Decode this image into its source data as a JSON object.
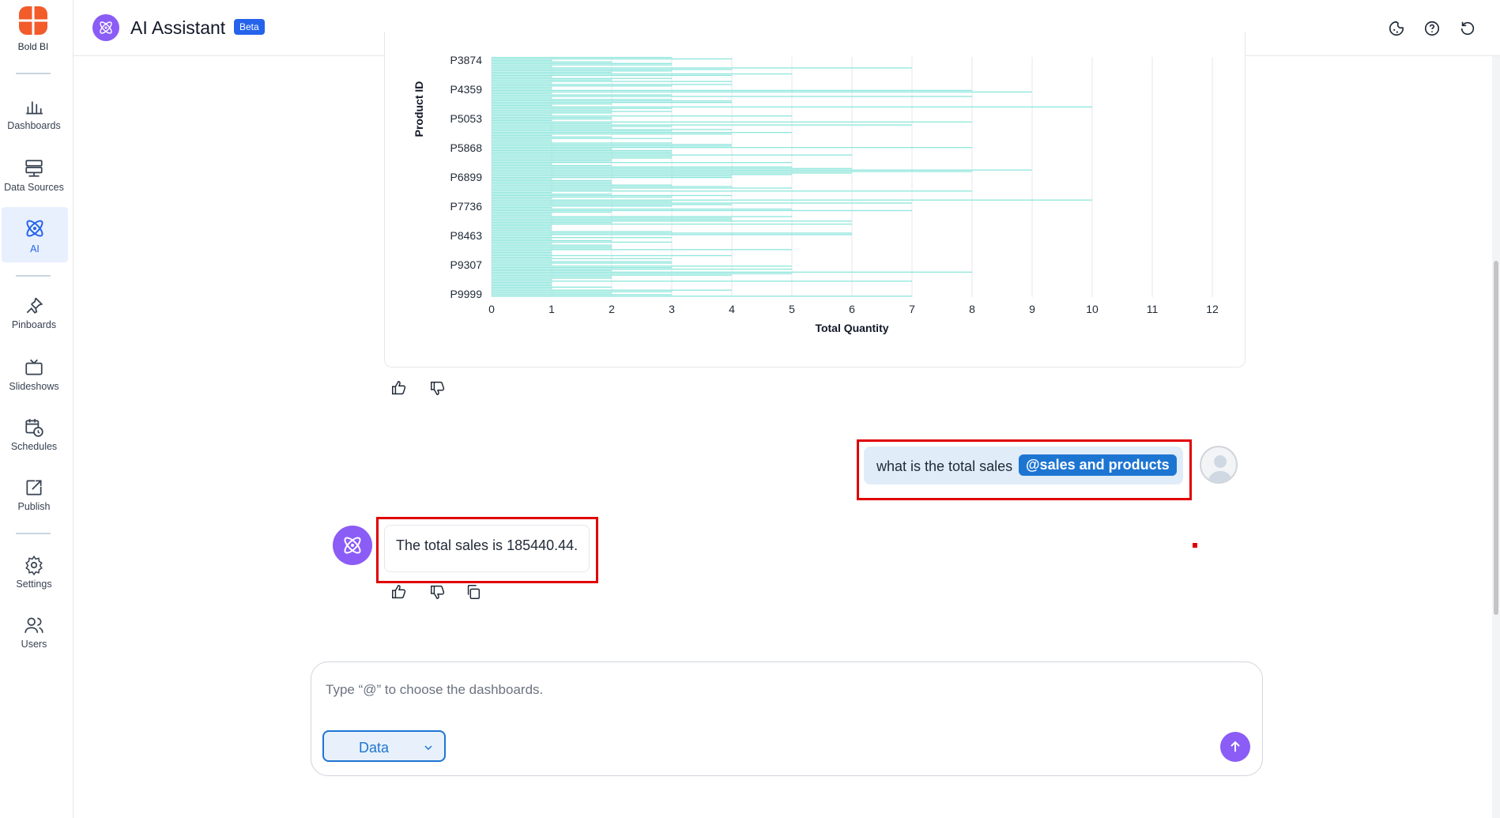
{
  "app": {
    "brand": "Bold BI",
    "title": "AI Assistant",
    "badge": "Beta"
  },
  "sidebar": {
    "items": [
      {
        "label": "Dashboards",
        "icon": "bar-chart-icon"
      },
      {
        "label": "Data Sources",
        "icon": "server-icon"
      },
      {
        "label": "AI",
        "icon": "atom-icon",
        "active": true
      },
      {
        "label": "Pinboards",
        "icon": "pin-icon"
      },
      {
        "label": "Slideshows",
        "icon": "tv-icon"
      },
      {
        "label": "Schedules",
        "icon": "calendar-clock-icon"
      },
      {
        "label": "Publish",
        "icon": "publish-icon"
      },
      {
        "label": "Settings",
        "icon": "gear-icon"
      },
      {
        "label": "Users",
        "icon": "users-icon"
      }
    ]
  },
  "header": {
    "icons": [
      "theme-icon",
      "help-icon",
      "refresh-icon"
    ]
  },
  "chart_data": {
    "type": "bar",
    "orientation": "horizontal",
    "xlabel": "Total Quantity",
    "ylabel": "Product ID",
    "xlim": [
      0,
      12
    ],
    "xticks": [
      0,
      1,
      2,
      3,
      4,
      5,
      6,
      7,
      8,
      9,
      10,
      11,
      12
    ],
    "categories_visible": [
      "P3874",
      "P4359",
      "P5053",
      "P5868",
      "P6899",
      "P7736",
      "P8463",
      "P9307",
      "P9999"
    ],
    "values_visible_sample": [
      8,
      9,
      10,
      6,
      8,
      9,
      10,
      7,
      9
    ],
    "grid": true,
    "color": "#8ee6dc"
  },
  "chat": {
    "user_message": "what is the total sales",
    "user_mention": "@sales and products",
    "bot_message": "The total sales is 185440.44."
  },
  "input": {
    "placeholder": "Type “@” to choose the dashboards.",
    "value": "",
    "data_select": "Data"
  },
  "colors": {
    "accent": "#8b5cf6",
    "primary": "#1d75d2",
    "highlight": "#e00000",
    "bar": "#8ee6dc"
  }
}
